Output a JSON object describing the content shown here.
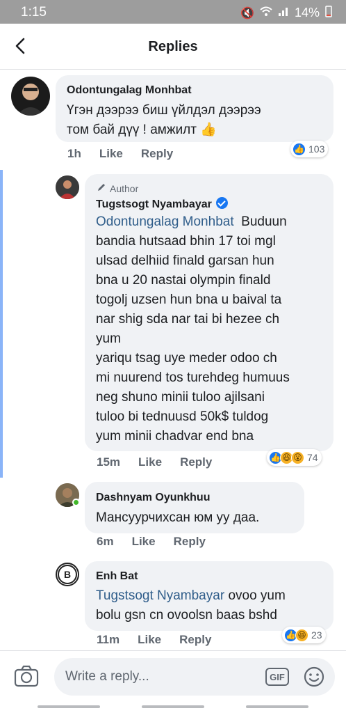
{
  "status_bar": {
    "time": "1:15",
    "battery": "14%"
  },
  "header": {
    "title": "Replies"
  },
  "comments": [
    {
      "name": "Odontungalag Monhbat",
      "text_lines": [
        "Үгэн дээрээ биш үйлдэл дээрээ",
        "том бай дүү ! амжилт 👍"
      ],
      "time": "1h",
      "like": "Like",
      "reply": "Reply",
      "reaction_count": "103"
    },
    {
      "author_label": "Author",
      "name": "Tugstsogt Nyambayar",
      "mention": "Odontungalag Monhbat",
      "text_first": "Buduun",
      "text_lines": [
        "bandia hutsaad bhin 17 toi mgl",
        "ulsad delhiid finald garsan hun",
        "bna u 20 nastai olympin finald",
        "togolj uzsen hun bna u baival ta",
        "nar shig sda nar tai bi hezee ch",
        "yum",
        "yariqu tsag uye meder odoo ch",
        "mi nuurend tos turehdeg humuus",
        "neg shuno minii tuloo ajilsani",
        "tuloo bi tednuusd 50k$ tuldog",
        "yum minii chadvar end bna"
      ],
      "time": "15m",
      "like": "Like",
      "reply": "Reply",
      "reaction_count": "74"
    },
    {
      "name": "Dashnyam Oyunkhuu",
      "text_lines": [
        "Мансуурчихсан юм уу даа."
      ],
      "time": "6m",
      "like": "Like",
      "reply": "Reply"
    },
    {
      "name": "Enh Bat",
      "mention": "Tugstsogt Nyambayar",
      "text_first": "ovoo yum",
      "text_lines": [
        "bolu gsn cn ovoolsn baas bshd"
      ],
      "time": "11m",
      "like": "Like",
      "reply": "Reply",
      "reaction_count": "23"
    }
  ],
  "composer": {
    "placeholder": "Write a reply...",
    "gif": "GIF"
  },
  "colors": {
    "accent": "#1877f2",
    "mention": "#2f5d8a",
    "bubble": "#f0f2f5",
    "thread_line": "#8ab4f8"
  }
}
